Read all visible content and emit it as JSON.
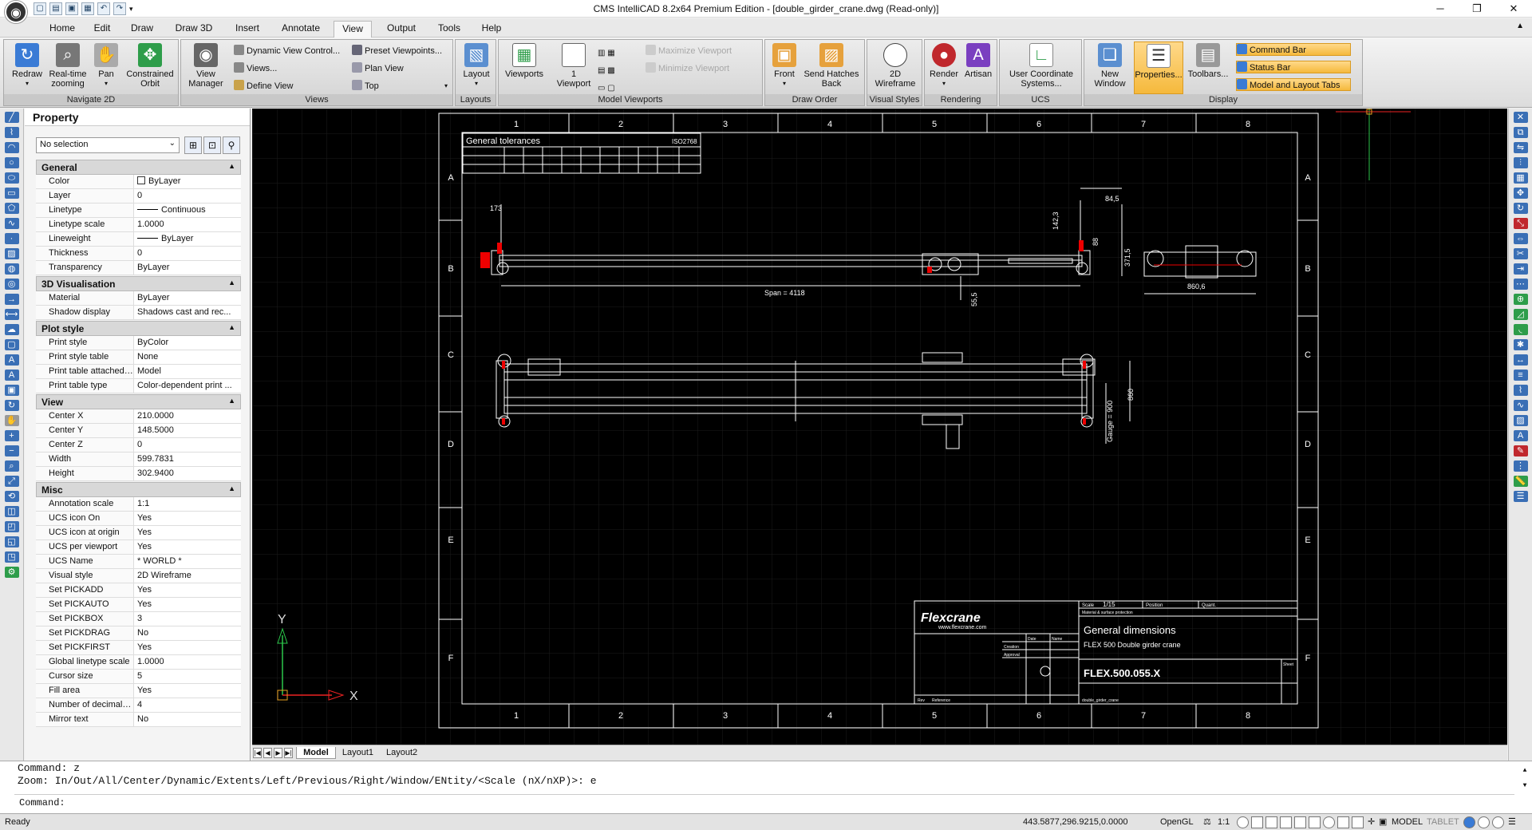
{
  "window": {
    "title": "CMS IntelliCAD 8.2x64 Premium Edition  - [double_girder_crane.dwg (Read-only)]"
  },
  "ribbon_tabs": [
    "Home",
    "Edit",
    "Draw",
    "Draw 3D",
    "Insert",
    "Annotate",
    "View",
    "Output",
    "Tools",
    "Help"
  ],
  "groups": {
    "navigate": {
      "label": "Navigate 2D",
      "redraw": "Redraw",
      "realtime": "Real-time",
      "realtime2": "zooming",
      "pan": "Pan",
      "orbit": "Constrained",
      "orbit2": "Orbit"
    },
    "views": {
      "label": "Views",
      "view_manager": "View",
      "view_manager2": "Manager",
      "dynamic": "Dynamic View Control...",
      "views_btn": "Views...",
      "define": "Define View",
      "preset": "Preset Viewpoints...",
      "plan": "Plan View",
      "top": "Top"
    },
    "layouts": {
      "label": "Layouts",
      "layout": "Layout"
    },
    "model_viewports": {
      "label": "Model Viewports",
      "viewports": "Viewports",
      "one": "1",
      "one2": "Viewport",
      "maximize": "Maximize Viewport",
      "minimize": "Minimize Viewport"
    },
    "draw_order": {
      "label": "Draw Order",
      "front": "Front",
      "send": "Send Hatches",
      "send2": "Back"
    },
    "visual_styles": {
      "label": "Visual Styles",
      "wire": "2D",
      "wire2": "Wireframe"
    },
    "rendering": {
      "label": "Rendering",
      "render": "Render",
      "artisan": "Artisan"
    },
    "ucs": {
      "label": "UCS",
      "ucs": "User Coordinate",
      "ucs2": "Systems..."
    },
    "display": {
      "label": "Display",
      "new_window": "New",
      "new_window2": "Window",
      "properties": "Properties...",
      "toolbars": "Toolbars...",
      "command_bar": "Command Bar",
      "status_bar": "Status Bar",
      "model_layout": "Model and Layout Tabs"
    }
  },
  "property": {
    "title": "Property",
    "selection": "No selection",
    "sections": [
      {
        "name": "General",
        "rows": [
          [
            "Color",
            "ByLayer"
          ],
          [
            "Layer",
            "0"
          ],
          [
            "Linetype",
            "Continuous"
          ],
          [
            "Linetype scale",
            "1.0000"
          ],
          [
            "Lineweight",
            "ByLayer"
          ],
          [
            "Thickness",
            "0"
          ],
          [
            "Transparency",
            "ByLayer"
          ]
        ]
      },
      {
        "name": "3D Visualisation",
        "rows": [
          [
            "Material",
            "ByLayer"
          ],
          [
            "Shadow display",
            "Shadows cast and rec..."
          ]
        ]
      },
      {
        "name": "Plot style",
        "rows": [
          [
            "Print style",
            "ByColor"
          ],
          [
            "Print style table",
            "None"
          ],
          [
            "Print table attached to",
            "Model"
          ],
          [
            "Print table type",
            "Color-dependent print ..."
          ]
        ]
      },
      {
        "name": "View",
        "rows": [
          [
            "Center X",
            "210.0000"
          ],
          [
            "Center Y",
            "148.5000"
          ],
          [
            "Center Z",
            "0"
          ],
          [
            "Width",
            "599.7831"
          ],
          [
            "Height",
            "302.9400"
          ]
        ]
      },
      {
        "name": "Misc",
        "rows": [
          [
            "Annotation scale",
            "1:1"
          ],
          [
            "UCS icon On",
            "Yes"
          ],
          [
            "UCS icon at origin",
            "Yes"
          ],
          [
            "UCS per viewport",
            "Yes"
          ],
          [
            "UCS Name",
            "* WORLD *"
          ],
          [
            "Visual style",
            "2D Wireframe"
          ],
          [
            "Set PICKADD",
            "Yes"
          ],
          [
            "Set PICKAUTO",
            "Yes"
          ],
          [
            "Set PICKBOX",
            "3"
          ],
          [
            "Set PICKDRAG",
            "No"
          ],
          [
            "Set PICKFIRST",
            "Yes"
          ],
          [
            "Global linetype scale",
            "1.0000"
          ],
          [
            "Cursor size",
            "5"
          ],
          [
            "Fill area",
            "Yes"
          ],
          [
            "Number of decimal pla...",
            "4"
          ],
          [
            "Mirror text",
            "No"
          ]
        ]
      }
    ]
  },
  "drawing": {
    "col_labels": [
      "1",
      "2",
      "3",
      "4",
      "5",
      "6",
      "7",
      "8"
    ],
    "row_labels": [
      "A",
      "B",
      "C",
      "D",
      "E",
      "F"
    ],
    "tolerances_title": "General tolerances",
    "tolerances_std": "ISO2768",
    "dim_173": "173",
    "dim_845": "84,5",
    "dim_1423": "142,3",
    "dim_88": "88",
    "dim_3715": "371,5",
    "dim_span": "Span = 4118",
    "dim_555": "55,5",
    "dim_8606": "860,6",
    "dim_860": "860",
    "dim_gauge": "Gauge = 900",
    "brand": "Flexcrane",
    "brand_url": "www.flexcrane.com",
    "tb_scale_label": "Scale",
    "tb_scale": "1/15",
    "tb_position": "Position",
    "tb_quant": "Quant.",
    "tb_material": "Material & surface protection",
    "tb_date": "Date",
    "tb_name": "Name",
    "tb_creation": "Creation",
    "tb_approval": "Approval",
    "tb_title": "General dimensions",
    "tb_subtitle": "FLEX 500 Double girder crane",
    "tb_number": "FLEX.500.055.X",
    "tb_sheet": "Sheet",
    "tb_rev": "Rev",
    "tb_reference": "Reference",
    "tb_file": "double_girder_crane",
    "ucs_x": "X",
    "ucs_y": "Y"
  },
  "layout_tabs": [
    "Model",
    "Layout1",
    "Layout2"
  ],
  "command": {
    "line1": "Command: z",
    "line2": "Zoom:  In/Out/All/Center/Dynamic/Extents/Left/Previous/Right/Window/ENtity/<Scale (nX/nXP)>: e",
    "prompt": "Command:"
  },
  "status": {
    "ready": "Ready",
    "coords": "443.5877,296.9215,0.0000",
    "opengl": "OpenGL",
    "scale": "1:1",
    "model": "MODEL",
    "tablet": "TABLET"
  }
}
